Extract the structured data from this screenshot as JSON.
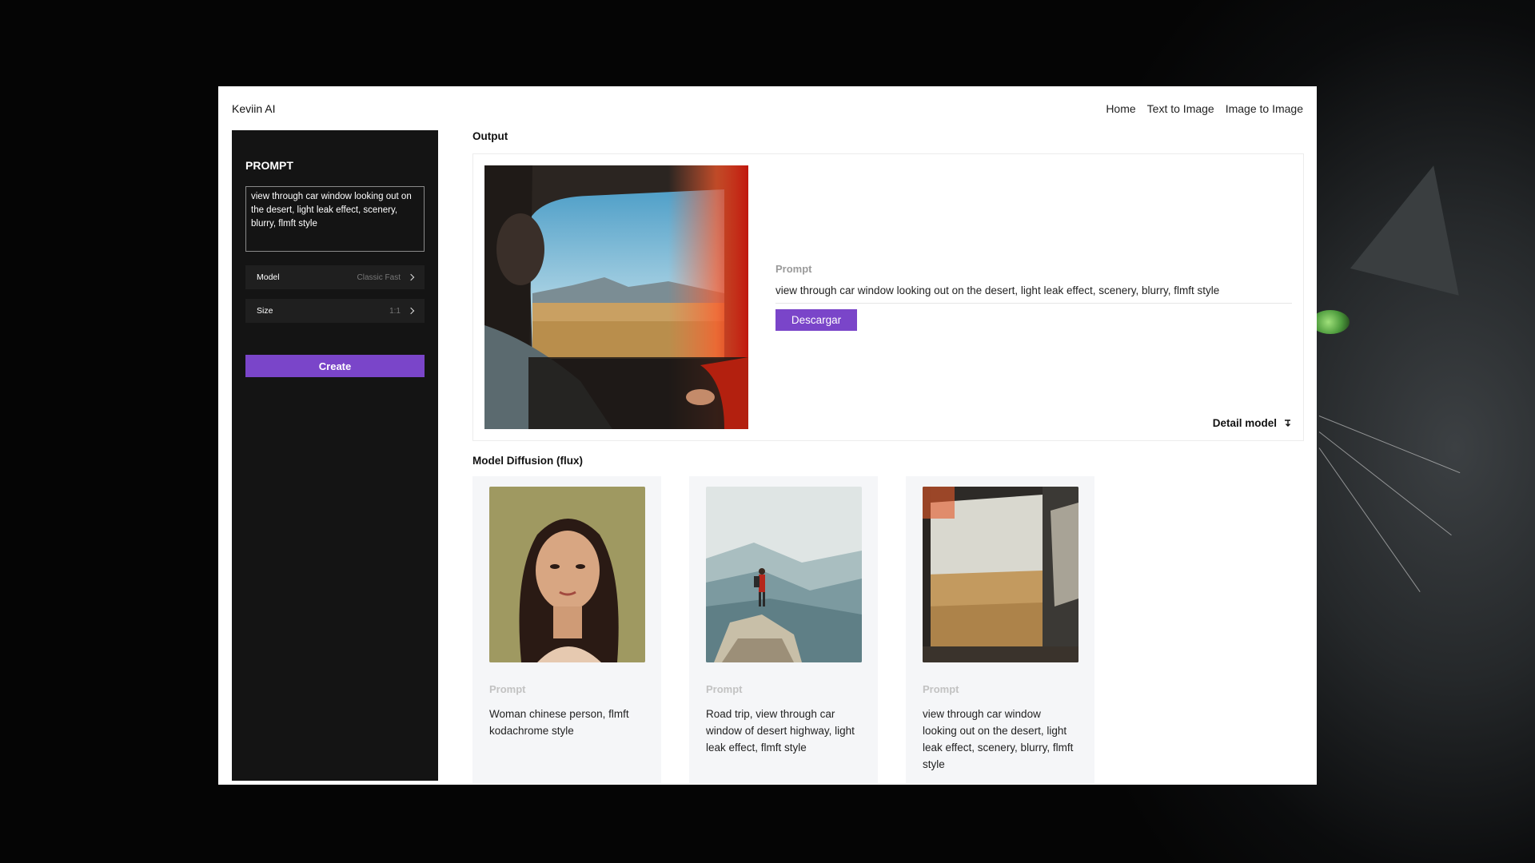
{
  "app": {
    "brand": "Keviin AI"
  },
  "nav": {
    "items": [
      "Home",
      "Text to Image",
      "Image to Image"
    ]
  },
  "sidebar": {
    "title": "PROMPT",
    "prompt_value": "view through car window looking out on the desert, light leak effect, scenery, blurry, flmft style",
    "model_label": "Model",
    "model_value": "Classic Fast",
    "size_label": "Size",
    "size_value": "1:1",
    "create_label": "Create"
  },
  "output": {
    "title": "Output",
    "prompt_label": "Prompt",
    "prompt_text": "view through car window looking out on the desert, light leak effect, scenery, blurry, flmft style",
    "download_label": "Descargar",
    "detail_label": "Detail model"
  },
  "gallery": {
    "title": "Model Diffusion (flux)",
    "items": [
      {
        "prompt_label": "Prompt",
        "text": "Woman chinese person, flmft kodachrome style",
        "icon": "portrait-image"
      },
      {
        "prompt_label": "Prompt",
        "text": "Road trip, view through car window of desert highway, light leak effect, flmft style",
        "icon": "mountain-hiker-image"
      },
      {
        "prompt_label": "Prompt",
        "text": "view through car window looking out on the desert, light leak effect, scenery, blurry, flmft style",
        "icon": "desert-car-window-image"
      }
    ]
  },
  "colors": {
    "accent": "#7a45c9",
    "sidebar_bg": "#141414",
    "card_bg": "#f5f6f8"
  }
}
